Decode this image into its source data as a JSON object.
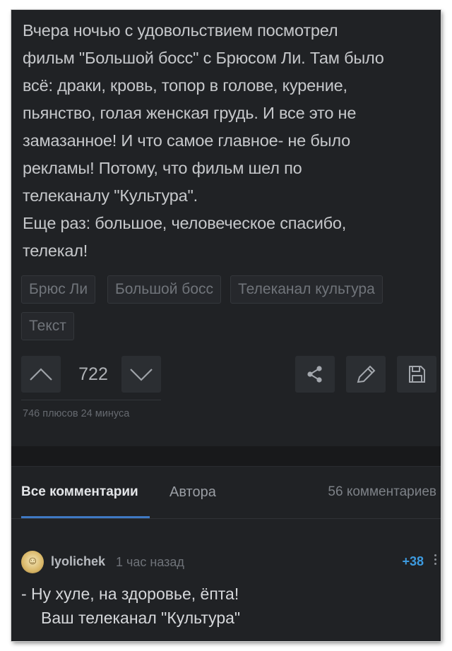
{
  "post": {
    "lines": [
      "Вчера ночью с удовольствием посмотрел",
      "фильм \"Большой босс\" с Брюсом Ли. Там было",
      "всё: драки, кровь, топор в голове, курение,",
      "пьянство, голая женская грудь. И все это не",
      "замазанное! И что самое главное- не было",
      "рекламы! Потому, что фильм шел по",
      "телеканалу \"Культура\".",
      "Еще раз: большое, человеческое спасибо,",
      "телекал!"
    ],
    "tags": [
      "Брюс Ли",
      "Большой босс",
      "Телеканал культура",
      "Текст"
    ]
  },
  "votes": {
    "rating": "722",
    "detail": "746 плюсов 24 минуса"
  },
  "icons": {
    "upvote": "chevron-up-icon",
    "downvote": "chevron-down-icon",
    "share": "share-icon",
    "edit": "pencil-icon",
    "save": "save-icon",
    "more": "more-vertical-icon"
  },
  "comments_header": {
    "tab_all": "Все комментарии",
    "tab_author": "Автора",
    "count": "56 комментариев"
  },
  "comment": {
    "author": "lyolichek",
    "time": "1 час назад",
    "rating": "+38",
    "line1": "- Ну хуле, на здоровье, ёпта!",
    "line2": "Ваш телеканал \"Культура\""
  },
  "colors": {
    "background": "#202225",
    "accent": "#3f79c4",
    "rating_positive": "#3d9be0"
  }
}
